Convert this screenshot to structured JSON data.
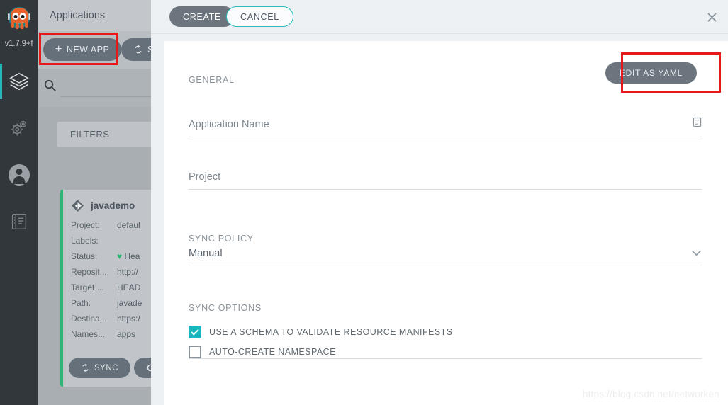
{
  "nav": {
    "version": "v1.7.9+f",
    "logo_icon": "argo-octopus-logo",
    "items": [
      {
        "icon": "applications-stack-icon",
        "name": "applications",
        "active": true
      },
      {
        "icon": "settings-gears-icon",
        "name": "settings",
        "active": false
      },
      {
        "icon": "user-avatar-icon",
        "name": "user-info",
        "active": false
      },
      {
        "icon": "documentation-book-icon",
        "name": "documentation",
        "active": false
      }
    ]
  },
  "background": {
    "page_title": "Applications",
    "new_app_label": "NEW APP",
    "new_app_icon": "plus-icon",
    "sync_apps_label": "SY",
    "sync_apps_icon": "sync-refresh-icon",
    "search_icon": "search-icon",
    "search_placeholder": "",
    "filters_label": "FILTERS",
    "card": {
      "app_icon": "argo-app-diamond-icon",
      "app_name": "javademo",
      "rows": [
        {
          "key": "Project:",
          "value": "defaul"
        },
        {
          "key": "Labels:",
          "value": ""
        },
        {
          "key": "Status:",
          "value": "Hea",
          "icon": "heart-healthy-icon"
        },
        {
          "key": "Reposit...",
          "value": "http://"
        },
        {
          "key": "Target ...",
          "value": "HEAD"
        },
        {
          "key": "Path:",
          "value": "javade"
        },
        {
          "key": "Destina...",
          "value": "https:/"
        },
        {
          "key": "Names...",
          "value": "apps"
        }
      ],
      "sync_label": "SYNC",
      "sync_icon": "sync-refresh-icon",
      "refresh_label": "",
      "refresh_icon": "refresh-icon"
    }
  },
  "modal": {
    "create_label": "CREATE",
    "cancel_label": "CANCEL",
    "close_icon": "close-x-icon",
    "edit_yaml_label": "EDIT AS YAML",
    "general_label": "GENERAL",
    "app_name_placeholder": "Application Name",
    "app_name_value": "",
    "app_name_icon": "paste-clipboard-icon",
    "project_placeholder": "Project",
    "project_value": "",
    "sync_policy_label": "SYNC POLICY",
    "sync_policy_value": "Manual",
    "sync_policy_chevron": "chevron-down-icon",
    "sync_options_label": "SYNC OPTIONS",
    "options": [
      {
        "label": "USE A SCHEMA TO VALIDATE RESOURCE MANIFESTS",
        "checked": true
      },
      {
        "label": "AUTO-CREATE NAMESPACE",
        "checked": false
      }
    ]
  },
  "watermark": "https://blog.csdn.net/networken",
  "colors": {
    "accent_teal": "#17b8bd",
    "healthy_green": "#2bb673",
    "highlight_red": "#e8191b",
    "button_slate": "#6c757d",
    "nav_dark": "#32373c"
  }
}
